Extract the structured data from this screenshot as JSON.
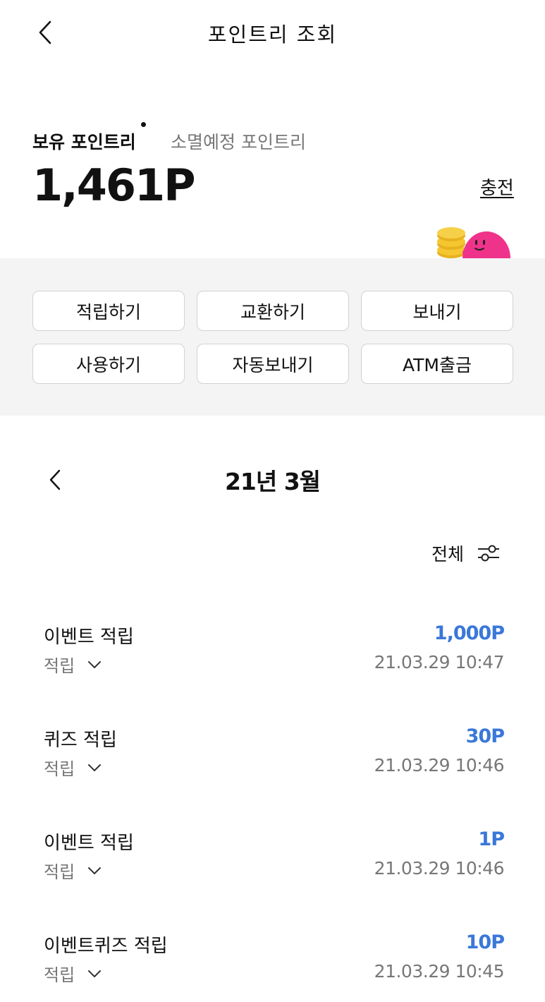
{
  "header": {
    "title": "포인트리 조회"
  },
  "tabs": {
    "active": "보유 포인트리",
    "inactive": "소멸예정 포인트리"
  },
  "balance": "1,461P",
  "charge_label": "충전",
  "actions": [
    "적립하기",
    "교환하기",
    "보내기",
    "사용하기",
    "자동보내기",
    "ATM출금"
  ],
  "month": {
    "label": "21년 3월"
  },
  "filter": {
    "label": "전체"
  },
  "transactions": [
    {
      "title": "이벤트 적립",
      "type": "적립",
      "amount": "1,000P",
      "datetime": "21.03.29 10:47"
    },
    {
      "title": "퀴즈 적립",
      "type": "적립",
      "amount": "30P",
      "datetime": "21.03.29 10:46"
    },
    {
      "title": "이벤트 적립",
      "type": "적립",
      "amount": "1P",
      "datetime": "21.03.29 10:46"
    },
    {
      "title": "이벤트퀴즈 적립",
      "type": "적립",
      "amount": "10P",
      "datetime": "21.03.29 10:45"
    }
  ],
  "colors": {
    "accent": "#3a78d8",
    "panel_bg": "#f4f4f4",
    "muted_text": "#777777",
    "mascot": "#f0338a",
    "coin": "#f5c630"
  },
  "icons": {
    "back": "chevron-left-icon",
    "filter": "sliders-icon",
    "expand": "chevron-down-icon"
  }
}
